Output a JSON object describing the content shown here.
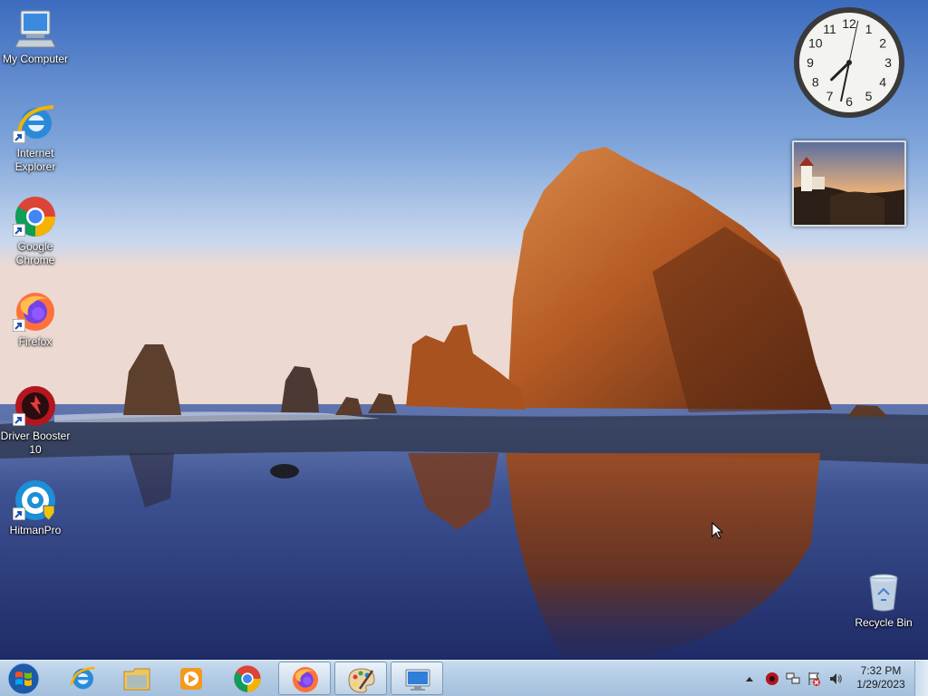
{
  "desktop": {
    "icons": [
      {
        "label": "My Computer",
        "icon": "computer-icon"
      },
      {
        "label": "Internet Explorer",
        "icon": "internet-explorer-icon"
      },
      {
        "label": "Google Chrome",
        "icon": "chrome-icon"
      },
      {
        "label": "Firefox",
        "icon": "firefox-icon"
      },
      {
        "label": "Driver Booster 10",
        "icon": "driver-booster-icon"
      },
      {
        "label": "HitmanPro",
        "icon": "hitmanpro-icon"
      },
      {
        "label": "Recycle Bin",
        "icon": "recycle-bin-icon"
      }
    ]
  },
  "gadgets": {
    "clock": {
      "hour": 7,
      "minute": 32,
      "second": 2
    },
    "photo": {
      "subject": "lighthouse-photo"
    }
  },
  "taskbar": {
    "start": "windows-start-icon",
    "pinned": [
      {
        "name": "internet-explorer",
        "active": false
      },
      {
        "name": "file-explorer",
        "active": false
      },
      {
        "name": "media-player",
        "active": false
      },
      {
        "name": "chrome",
        "active": false
      },
      {
        "name": "firefox",
        "active": true
      },
      {
        "name": "paint",
        "active": true
      },
      {
        "name": "remote-desktop",
        "active": true
      }
    ],
    "tray": {
      "time": "7:32 PM",
      "date": "1/29/2023",
      "icons": [
        "show-hidden-icon",
        "driver-booster-tray-icon",
        "network-icon",
        "action-center-icon",
        "volume-icon"
      ]
    }
  },
  "colors": {
    "taskbar": "#b3cce5",
    "sky_top": "#3f6fc0",
    "rock": "#c2652a"
  }
}
